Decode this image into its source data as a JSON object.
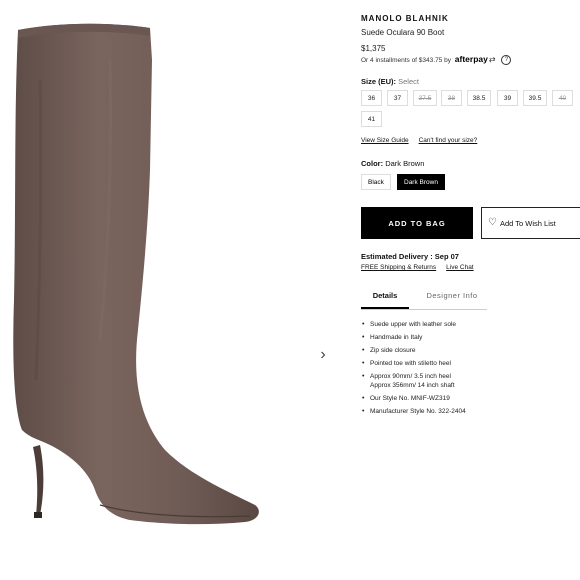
{
  "product": {
    "brand": "MANOLO BLAHNIK",
    "name": "Suede Ocularа 90 Boot",
    "price": "$1,375",
    "afterpay_text": "Or 4 installments of $343.75 by",
    "afterpay_logo": "afterpay",
    "afterpay_arrows": "⇄",
    "help_symbol": "?"
  },
  "size": {
    "label": "Size (EU):",
    "hint": "Select",
    "options": [
      {
        "label": "36",
        "available": true
      },
      {
        "label": "37",
        "available": true
      },
      {
        "label": "37.5",
        "available": false
      },
      {
        "label": "38",
        "available": false
      },
      {
        "label": "38.5",
        "available": true
      },
      {
        "label": "39",
        "available": true
      },
      {
        "label": "39.5",
        "available": true
      },
      {
        "label": "40",
        "available": false
      },
      {
        "label": "41",
        "available": true
      }
    ],
    "guide_link": "View Size Guide",
    "cant_find_link": "Can't find your size?"
  },
  "color": {
    "label": "Color:",
    "selected": "Dark Brown",
    "options": [
      "Black",
      "Dark Brown"
    ]
  },
  "actions": {
    "add_to_bag": "ADD TO BAG",
    "wishlist": "Add To Wish List",
    "wishlist_icon": "heart-icon"
  },
  "delivery": {
    "estimate": "Estimated Delivery : Sep 07",
    "shipping_link": "FREE Shipping & Returns",
    "chat_link": "Live Chat"
  },
  "tabs": [
    {
      "label": "Details",
      "active": true
    },
    {
      "label": "Designer Info",
      "active": false
    }
  ],
  "details": [
    "Suede upper with leather sole",
    "Handmade in Italy",
    "Zip side closure",
    "Pointed toe with stiletto heel",
    "Approx 90mm/ 3.5 inch heel",
    "Approx 356mm/ 14 inch shaft",
    "Our Style No. MNIF-WZ319",
    "Manufacturer Style No. 322-2404"
  ],
  "gallery": {
    "next_arrow": "›"
  },
  "colors": {
    "suede": "#735e58",
    "suede_dark": "#5a4843",
    "suede_light": "#8a746d",
    "accent": "#000000"
  }
}
